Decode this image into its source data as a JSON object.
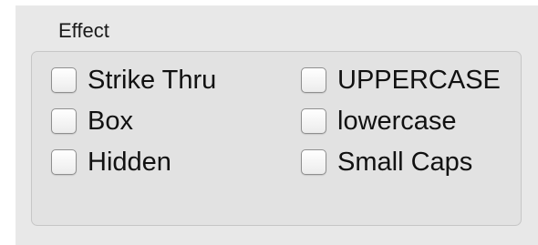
{
  "group": {
    "title": "Effect"
  },
  "checkboxes": [
    {
      "label": "Strike Thru",
      "checked": false
    },
    {
      "label": "Box",
      "checked": false
    },
    {
      "label": "Hidden",
      "checked": false
    },
    {
      "label": "UPPERCASE",
      "checked": false
    },
    {
      "label": "lowercase",
      "checked": false
    },
    {
      "label": "Small Caps",
      "checked": false
    }
  ]
}
